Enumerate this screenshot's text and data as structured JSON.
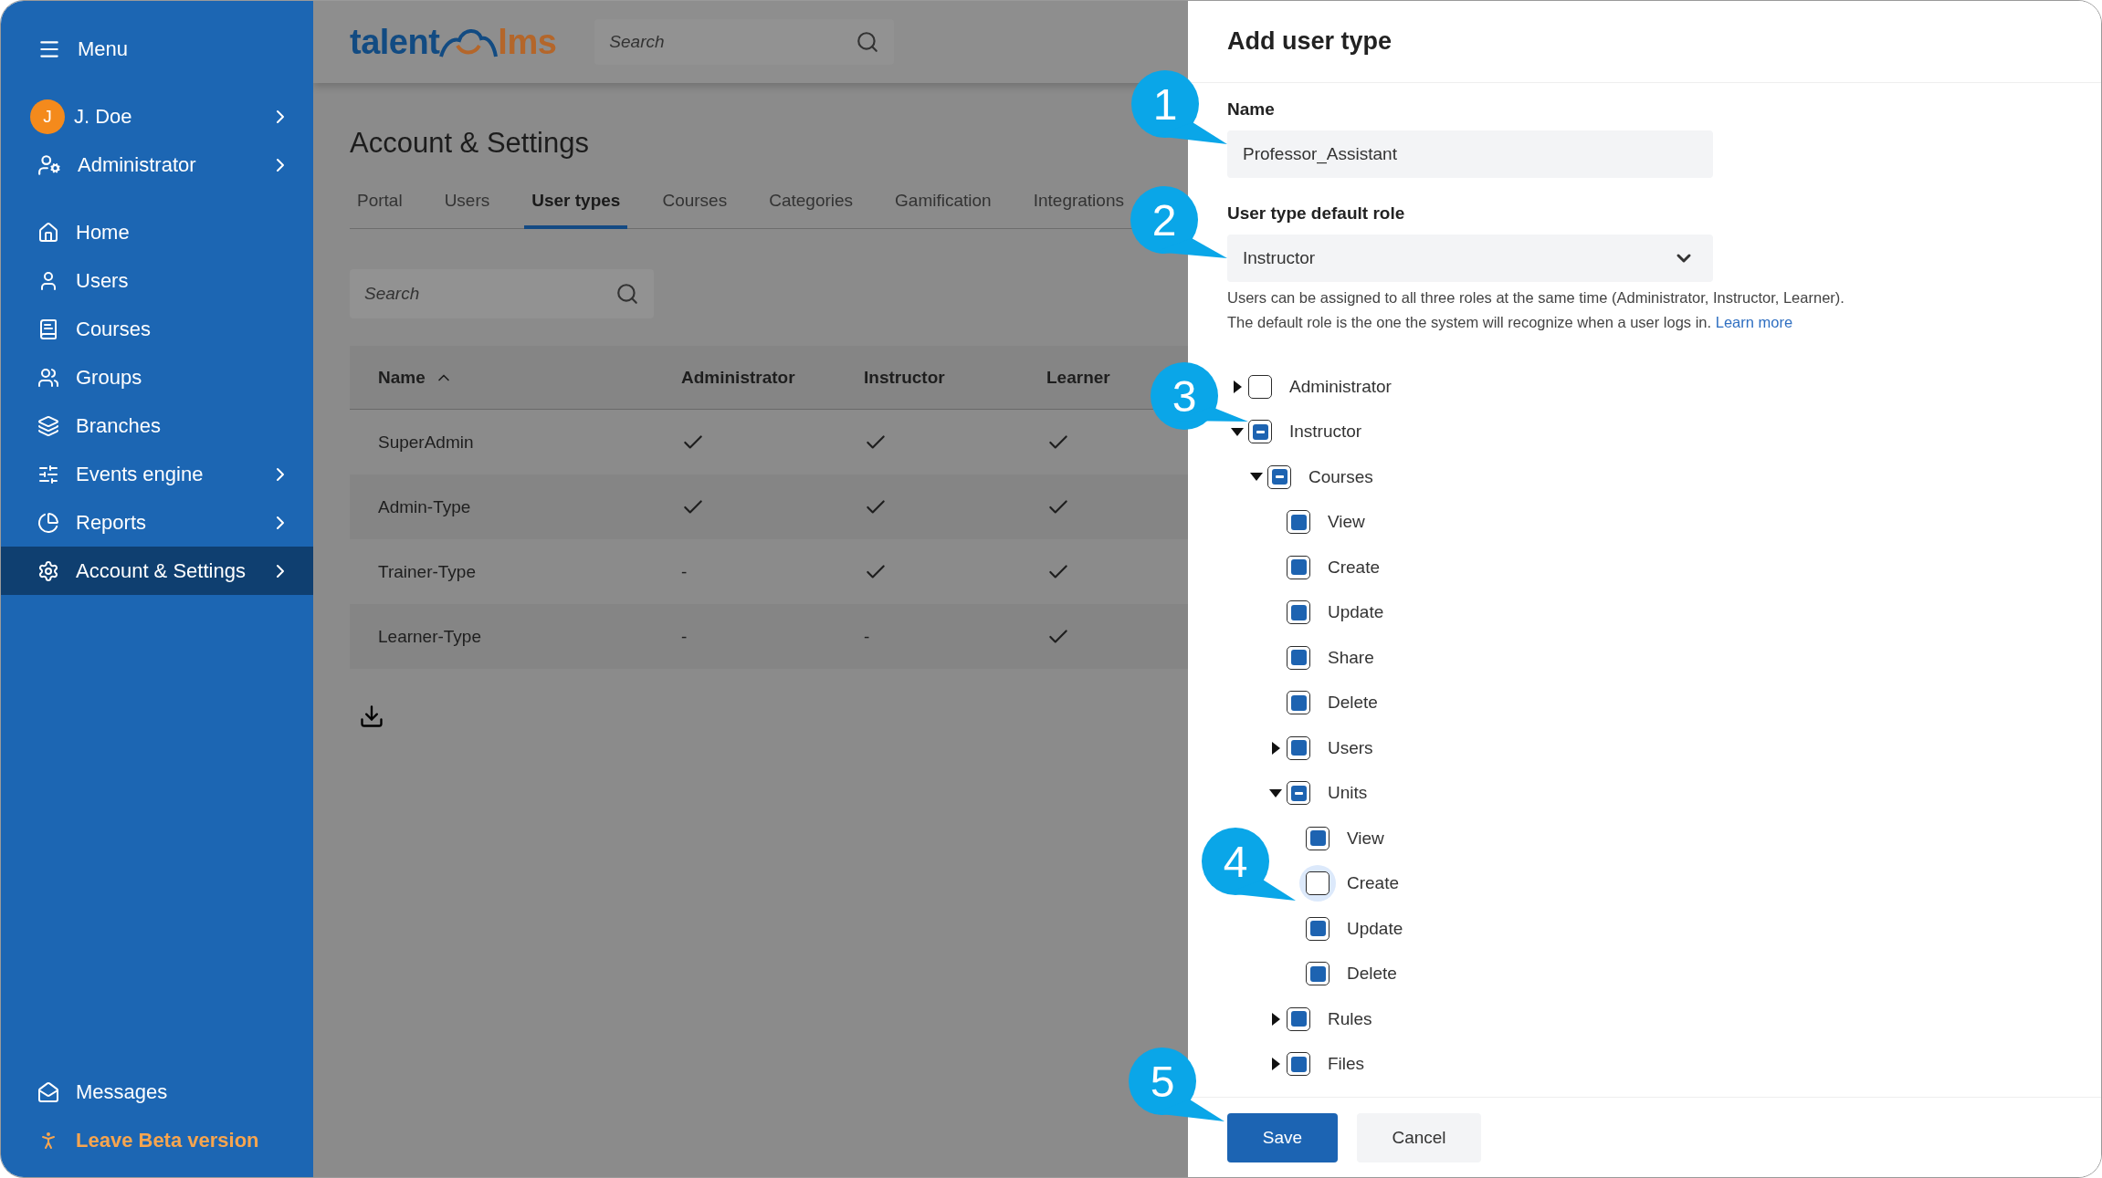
{
  "sidebar": {
    "menu_label": "Menu",
    "user": {
      "initial": "J",
      "name": "J. Doe",
      "has_submenu": true
    },
    "role": {
      "label": "Administrator",
      "has_submenu": true
    },
    "items": [
      {
        "label": "Home",
        "has_submenu": false,
        "selected": false
      },
      {
        "label": "Users",
        "has_submenu": false,
        "selected": false
      },
      {
        "label": "Courses",
        "has_submenu": false,
        "selected": false
      },
      {
        "label": "Groups",
        "has_submenu": false,
        "selected": false
      },
      {
        "label": "Branches",
        "has_submenu": false,
        "selected": false
      },
      {
        "label": "Events engine",
        "has_submenu": true,
        "selected": false
      },
      {
        "label": "Reports",
        "has_submenu": true,
        "selected": false
      },
      {
        "label": "Account & Settings",
        "has_submenu": true,
        "selected": true
      }
    ],
    "bottom_items": [
      {
        "label": "Messages",
        "kind": "normal"
      },
      {
        "label": "Leave Beta version",
        "kind": "highlight"
      }
    ]
  },
  "header": {
    "logo": {
      "left": "talent",
      "right": "lms"
    },
    "search": {
      "placeholder": "Search"
    }
  },
  "page": {
    "title": "Account & Settings",
    "tabs": [
      {
        "label": "Portal",
        "selected": false
      },
      {
        "label": "Users",
        "selected": false
      },
      {
        "label": "User types",
        "selected": true
      },
      {
        "label": "Courses",
        "selected": false
      },
      {
        "label": "Categories",
        "selected": false
      },
      {
        "label": "Gamification",
        "selected": false
      },
      {
        "label": "Integrations",
        "selected": false
      }
    ],
    "search": {
      "placeholder": "Search"
    },
    "table": {
      "columns": [
        {
          "label": "Name",
          "sorted": true
        },
        {
          "label": "Administrator",
          "sorted": false
        },
        {
          "label": "Instructor",
          "sorted": false
        },
        {
          "label": "Learner",
          "sorted": false
        }
      ],
      "rows": [
        {
          "cells": [
            {
              "kind": "text",
              "text": "SuperAdmin"
            },
            {
              "kind": "check"
            },
            {
              "kind": "check"
            },
            {
              "kind": "check"
            }
          ]
        },
        {
          "cells": [
            {
              "kind": "text",
              "text": "Admin-Type"
            },
            {
              "kind": "check"
            },
            {
              "kind": "check"
            },
            {
              "kind": "check"
            }
          ]
        },
        {
          "cells": [
            {
              "kind": "text",
              "text": "Trainer-Type"
            },
            {
              "kind": "text",
              "text": "-"
            },
            {
              "kind": "check"
            },
            {
              "kind": "check"
            }
          ]
        },
        {
          "cells": [
            {
              "kind": "text",
              "text": "Learner-Type"
            },
            {
              "kind": "text",
              "text": "-"
            },
            {
              "kind": "text",
              "text": "-"
            },
            {
              "kind": "check"
            }
          ]
        }
      ]
    }
  },
  "panel": {
    "title": "Add user type",
    "name_field": {
      "label": "Name",
      "value": "Professor_Assistant"
    },
    "role_field": {
      "label": "User type default role",
      "value": "Instructor"
    },
    "help_lines": [
      {
        "text": "Users can be assigned to all three roles at the same time (Administrator, Instructor, Learner)."
      },
      {
        "text": "The default role is the one the system will recognize when a user logs in.",
        "link": "Learn more"
      }
    ],
    "tree": [
      {
        "label": "Administrator",
        "checked": false,
        "partial": false,
        "expanded": false,
        "focused": false
      },
      {
        "label": "Instructor",
        "partial": true,
        "expanded": true,
        "focused": false,
        "children": [
          {
            "label": "Courses",
            "partial": true,
            "expanded": true,
            "focused": false,
            "children": [
              {
                "label": "View",
                "checked": true,
                "partial": false,
                "focused": false
              },
              {
                "label": "Create",
                "checked": true,
                "partial": false,
                "focused": false
              },
              {
                "label": "Update",
                "checked": true,
                "partial": false,
                "focused": false
              },
              {
                "label": "Share",
                "checked": true,
                "partial": false,
                "focused": false
              },
              {
                "label": "Delete",
                "checked": true,
                "partial": false,
                "focused": false
              },
              {
                "label": "Users",
                "checked": true,
                "partial": false,
                "expanded": false,
                "focused": false
              },
              {
                "label": "Units",
                "partial": true,
                "expanded": true,
                "focused": false,
                "children": [
                  {
                    "label": "View",
                    "checked": true,
                    "partial": false,
                    "focused": false
                  },
                  {
                    "label": "Create",
                    "checked": false,
                    "partial": false,
                    "focused": true
                  },
                  {
                    "label": "Update",
                    "checked": true,
                    "partial": false,
                    "focused": false
                  },
                  {
                    "label": "Delete",
                    "checked": true,
                    "partial": false,
                    "focused": false
                  }
                ]
              },
              {
                "label": "Rules",
                "checked": true,
                "partial": false,
                "expanded": false,
                "focused": false
              },
              {
                "label": "Files",
                "checked": true,
                "partial": false,
                "expanded": false,
                "focused": false
              }
            ]
          }
        ]
      }
    ],
    "buttons": [
      {
        "label": "Save",
        "kind": "primary"
      },
      {
        "label": "Cancel",
        "kind": "secondary"
      }
    ]
  },
  "callouts": [
    "1",
    "2",
    "3",
    "4",
    "5"
  ]
}
